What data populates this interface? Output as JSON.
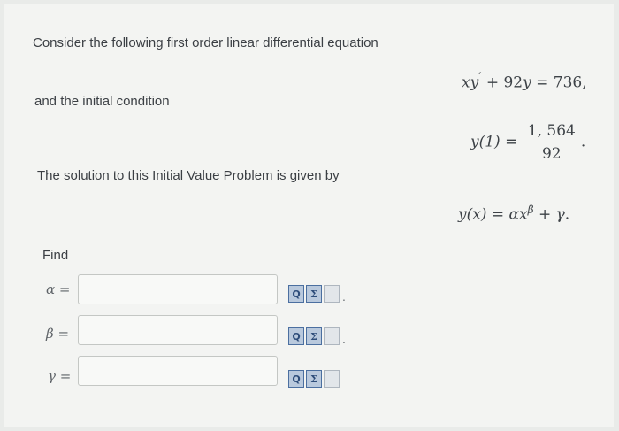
{
  "question": {
    "intro": "Consider the following first order linear differential equation",
    "equation": {
      "x": "x",
      "y": "y",
      "prime": "′",
      "plus": "+ 92",
      "eq": "= 736,"
    },
    "ic_text": "and the initial condition",
    "initial_condition": {
      "lhs": "y(1)",
      "eq": "=",
      "numerator": "1, 564",
      "denominator": "92",
      "end": "."
    },
    "solution_text": "The solution to this Initial Value Problem is given by",
    "solution_form": {
      "lhs": "y(x)",
      "eq": "=",
      "alpha": "α",
      "x": "x",
      "beta": "β",
      "plus": "+",
      "gamma": "γ",
      "end": "."
    },
    "find": "Find"
  },
  "answers": [
    {
      "symbol": "α",
      "eq": "=",
      "value": "",
      "placeholder": ""
    },
    {
      "symbol": "β",
      "eq": "=",
      "value": "",
      "placeholder": ""
    },
    {
      "symbol": "γ",
      "eq": "=",
      "value": "",
      "placeholder": ""
    }
  ],
  "tools": {
    "preview_icon": "preview-icon",
    "sigma_icon": "sigma-icon",
    "help_icon": "help-icon",
    "preview_glyph": "Q",
    "sigma_glyph": "Σ",
    "period": "."
  }
}
